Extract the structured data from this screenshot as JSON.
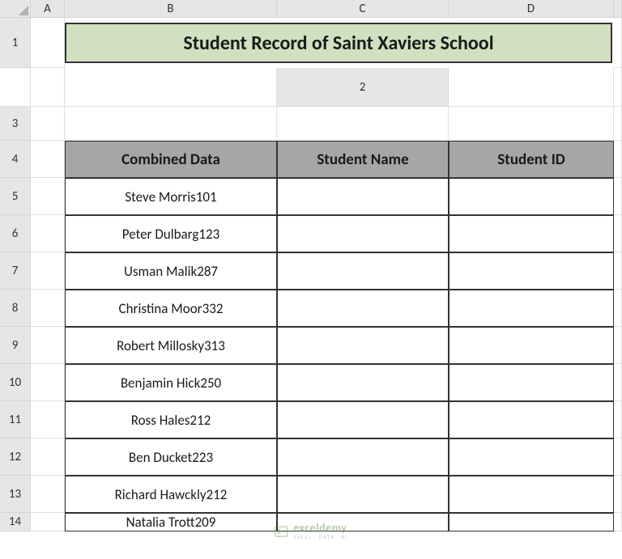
{
  "columns": [
    "",
    "A",
    "B",
    "C",
    "D",
    ""
  ],
  "rows": [
    "1",
    "2",
    "3",
    "4",
    "5",
    "6",
    "7",
    "8",
    "9",
    "10",
    "11",
    "12",
    "13",
    "14"
  ],
  "title": "Student Record of Saint Xaviers School",
  "headers": {
    "combined": "Combined Data",
    "name": "Student Name",
    "id": "Student ID"
  },
  "data": [
    {
      "combined": "Steve Morris101",
      "name": "",
      "id": ""
    },
    {
      "combined": "Peter Dulbarg123",
      "name": "",
      "id": ""
    },
    {
      "combined": "Usman Malik287",
      "name": "",
      "id": ""
    },
    {
      "combined": "Christina Moor332",
      "name": "",
      "id": ""
    },
    {
      "combined": "Robert Millosky313",
      "name": "",
      "id": ""
    },
    {
      "combined": "Benjamin Hick250",
      "name": "",
      "id": ""
    },
    {
      "combined": "Ross Hales212",
      "name": "",
      "id": ""
    },
    {
      "combined": "Ben Ducket223",
      "name": "",
      "id": ""
    },
    {
      "combined": "Richard Hawckly212",
      "name": "",
      "id": ""
    },
    {
      "combined": "Natalia Trott209",
      "name": "",
      "id": ""
    }
  ],
  "watermark": {
    "main": "exceldemy",
    "sub": "EXCEL · DATA · BI"
  },
  "chart_data": {
    "type": "table",
    "title": "Student Record of Saint Xaviers School",
    "columns": [
      "Combined Data",
      "Student Name",
      "Student ID"
    ],
    "rows": [
      [
        "Steve Morris101",
        "",
        ""
      ],
      [
        "Peter Dulbarg123",
        "",
        ""
      ],
      [
        "Usman Malik287",
        "",
        ""
      ],
      [
        "Christina Moor332",
        "",
        ""
      ],
      [
        "Robert Millosky313",
        "",
        ""
      ],
      [
        "Benjamin Hick250",
        "",
        ""
      ],
      [
        "Ross Hales212",
        "",
        ""
      ],
      [
        "Ben Ducket223",
        "",
        ""
      ],
      [
        "Richard Hawckly212",
        "",
        ""
      ],
      [
        "Natalia Trott209",
        "",
        ""
      ]
    ]
  }
}
